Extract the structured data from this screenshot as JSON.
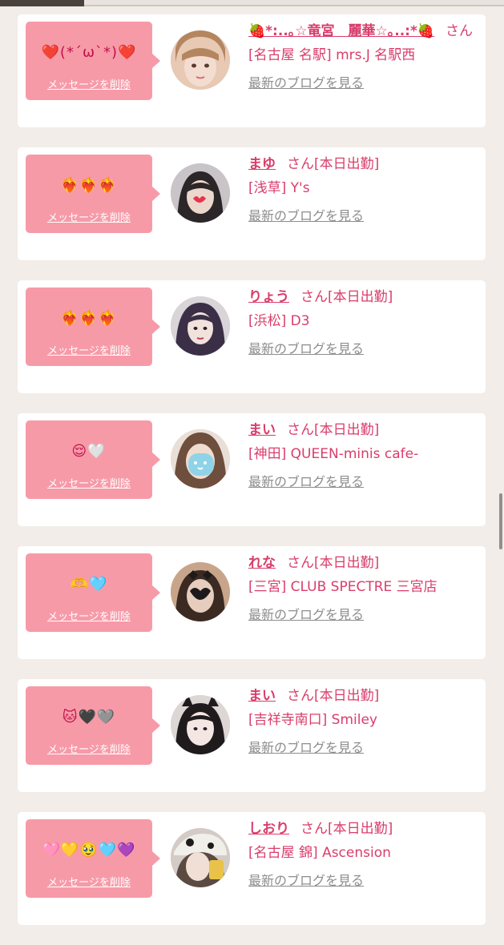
{
  "messages": [
    {
      "emoji": "❤️(*´ω`*)❤️",
      "delete_label": "メッセージを削除",
      "name": "🍓*:..｡☆竜宮　麗華☆｡..:*🍓",
      "suffix": "さん",
      "status": "",
      "shop": "[名古屋 名駅] mrs.J 名駅西",
      "blog_label": "最新のブログを見る",
      "avatar_color": "#c9a27d"
    },
    {
      "emoji": "❤️‍🔥❤️‍🔥❤️‍🔥",
      "delete_label": "メッセージを削除",
      "name": "まゆ",
      "suffix": "さん",
      "status": "[本日出勤]",
      "shop": "[浅草] Y's",
      "blog_label": "最新のブログを見る",
      "avatar_color": "#6f6a70"
    },
    {
      "emoji": "❤️‍🔥❤️‍🔥❤️‍🔥",
      "delete_label": "メッセージを削除",
      "name": "りょう",
      "suffix": "さん",
      "status": "[本日出勤]",
      "shop": "[浜松] D3",
      "blog_label": "最新のブログを見る",
      "avatar_color": "#3b3340"
    },
    {
      "emoji": "😌🤍",
      "delete_label": "メッセージを削除",
      "name": "まい",
      "suffix": "さん",
      "status": "[本日出勤]",
      "shop": "[神田] QUEEN-minis cafe-",
      "blog_label": "最新のブログを見る",
      "avatar_color": "#9c8272"
    },
    {
      "emoji": "🫶🩵",
      "delete_label": "メッセージを削除",
      "name": "れな",
      "suffix": "さん",
      "status": "[本日出勤]",
      "shop": "[三宮] CLUB SPECTRE 三宮店",
      "blog_label": "最新のブログを見る",
      "avatar_color": "#8a6b52"
    },
    {
      "emoji": "🐱🖤🩶",
      "delete_label": "メッセージを削除",
      "name": "まい",
      "suffix": "さん",
      "status": "[本日出勤]",
      "shop": "[吉祥寺南口] Smiley",
      "blog_label": "最新のブログを見る",
      "avatar_color": "#2e2b2d"
    },
    {
      "emoji": "🩷💛🥹🩵💜",
      "delete_label": "メッセージを削除",
      "name": "しおり",
      "suffix": "さん",
      "status": "[本日出勤]",
      "shop": "[名古屋 錦] Ascension",
      "blog_label": "最新のブログを見る",
      "avatar_color": "#b8a8a0"
    }
  ]
}
